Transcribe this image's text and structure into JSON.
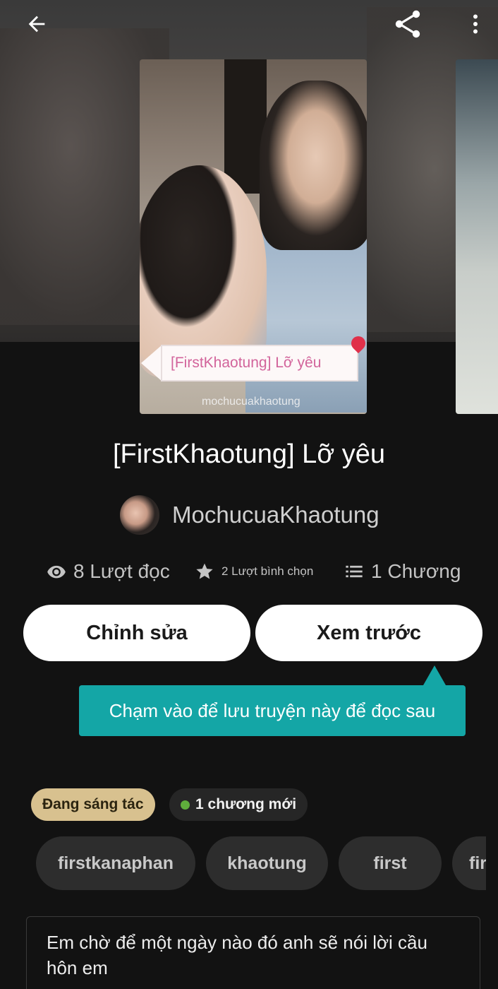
{
  "header": {
    "back_icon": "arrow-left-icon",
    "share_icon": "share-icon",
    "more_icon": "more-vertical-icon"
  },
  "cover": {
    "title_tag": "[FirstKhaotung] Lỡ yêu",
    "watermark": "mochucuakhaotung"
  },
  "story": {
    "title": "[FirstKhaotung] Lỡ yêu",
    "author": "MochucuaKhaotung"
  },
  "stats": {
    "reads": "8 Lượt đọc",
    "votes": "2 Lượt bình chọn",
    "parts": "1 Chương"
  },
  "actions": {
    "edit_label": "Chỉnh sửa",
    "preview_label": "Xem trước"
  },
  "tooltip": {
    "text": "Chạm vào để lưu truyện này để đọc sau"
  },
  "badges": {
    "status": "Đang sáng tác",
    "new_parts": "1 chương mới"
  },
  "tags": [
    "firstkanaphan",
    "khaotung",
    "first",
    "fir"
  ],
  "description": "Em chờ để một ngày nào đó anh sẽ nói lời cầu hôn em",
  "colors": {
    "background": "#121212",
    "tooltip": "#14a6a6",
    "status_badge": "#d8c18f",
    "new_dot": "#5fae3c",
    "tag_bg": "#2d2d2d"
  }
}
